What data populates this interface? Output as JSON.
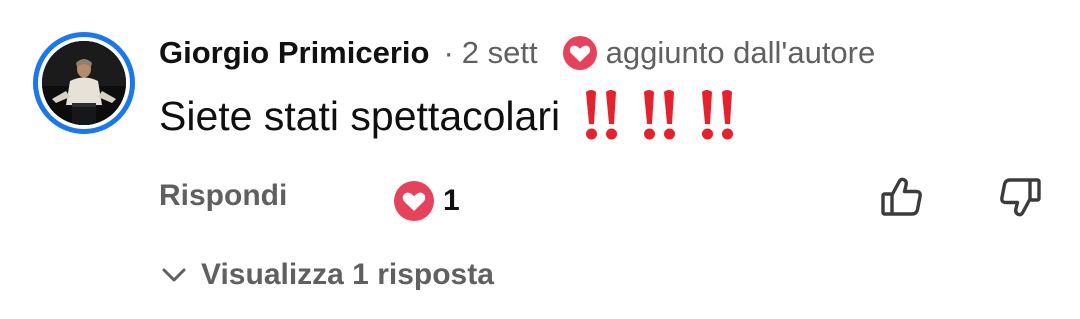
{
  "comment": {
    "author": "Giorgio Primicerio",
    "separator": "·",
    "time": "2 sett",
    "author_heart_label": "aggiunto dall'autore",
    "text": "Siete stati spettacolari",
    "emoji": [
      "‼️",
      "‼️",
      "‼️"
    ]
  },
  "actions": {
    "reply_label": "Rispondi",
    "like_count": "1",
    "thumb_up_icon": "thumb-up-icon",
    "thumb_down_icon": "thumb-down-icon"
  },
  "replies": {
    "label": "Visualizza 1 risposta",
    "icon": "chevron-down-icon"
  },
  "colors": {
    "avatar_ring": "#1877f2",
    "heart": "#e8415c",
    "emoji_red": "#e8202a",
    "secondary_text": "#606060"
  }
}
